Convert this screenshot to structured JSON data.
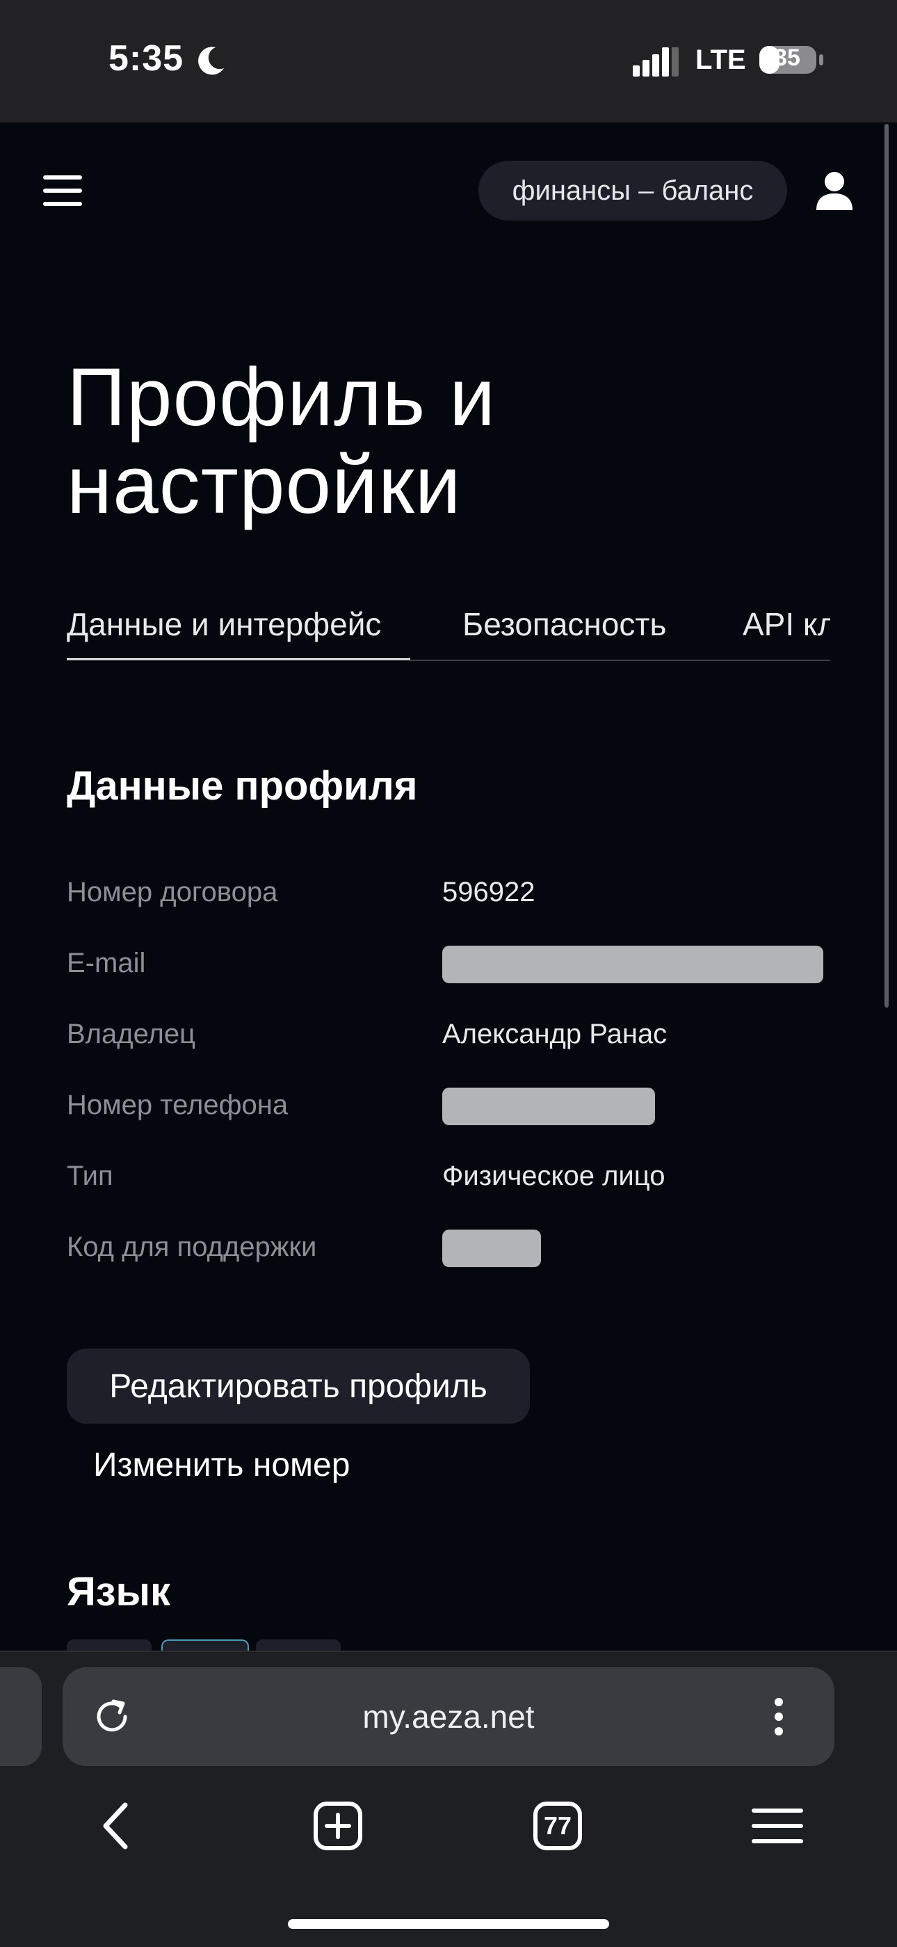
{
  "status_bar": {
    "time": "5:35",
    "network": "LTE",
    "battery": "35",
    "icons": [
      "moon-icon",
      "signal-icon",
      "battery-icon"
    ]
  },
  "header": {
    "finance_pill": "финансы – баланс",
    "icons": [
      "hamburger-menu-icon",
      "user-icon"
    ]
  },
  "page": {
    "title": "Профиль и настройки",
    "tabs": [
      {
        "label": "Данные и интерфейс",
        "active": true
      },
      {
        "label": "Безопасность",
        "active": false
      },
      {
        "label": "API кл",
        "active": false
      }
    ]
  },
  "profile": {
    "section_title": "Данные профиля",
    "rows": [
      {
        "label": "Номер договора",
        "value": "596922"
      },
      {
        "label": "E-mail",
        "value": ""
      },
      {
        "label": "Владелец",
        "value": "Александр Ранас"
      },
      {
        "label": "Номер телефона",
        "value": ""
      },
      {
        "label": "Тип",
        "value": "Физическое лицо"
      },
      {
        "label": "Код для поддержки",
        "value": ""
      }
    ],
    "edit_button": "Редактировать профиль",
    "change_phone": "Изменить номер"
  },
  "language": {
    "section_title": "Язык"
  },
  "browser": {
    "url": "my.aeza.net",
    "tab_count": "77",
    "icons": [
      "reload-icon",
      "more-vertical-icon",
      "back-icon",
      "new-tab-icon",
      "tabs-icon",
      "menu-icon"
    ]
  },
  "colors": {
    "background": "#05070e",
    "surface": "#1e2029",
    "muted_text": "#8d8f96",
    "redaction": "#b3b4b7"
  }
}
